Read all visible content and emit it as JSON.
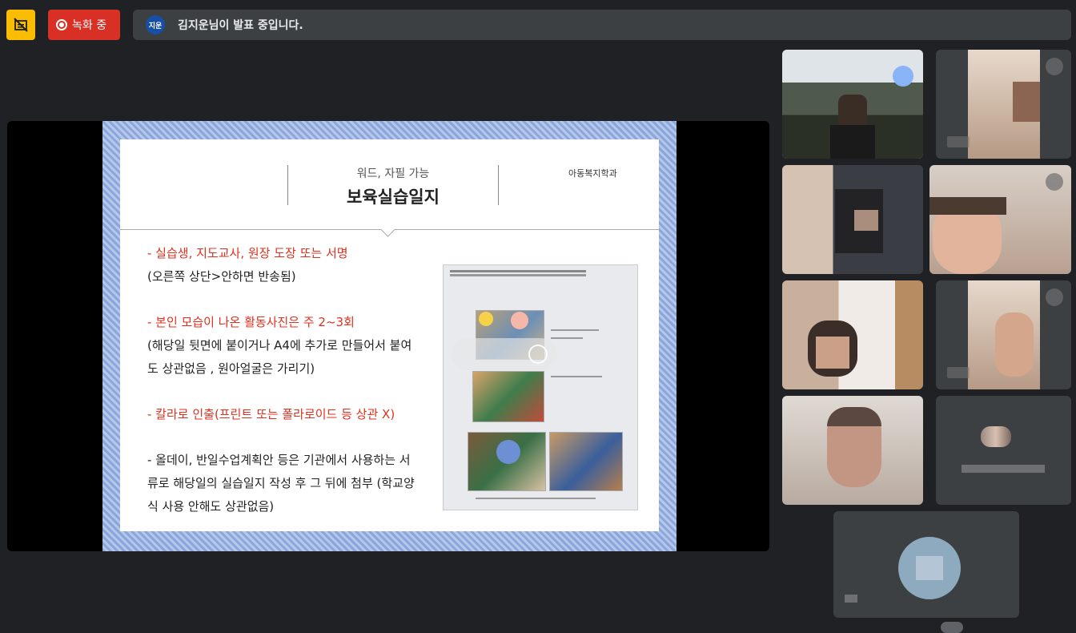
{
  "top_bar": {
    "captions_icon": "captions-off-icon",
    "recording_label": "녹화 중",
    "presenter_avatar_text": "지운",
    "presenter_status": "김지운님이 발표 중입니다."
  },
  "slide": {
    "subtitle": "워드, 자필 가능",
    "title": "보육실습일지",
    "department": "아동복지학과",
    "bullets": [
      {
        "text": "-  실습생, 지도교사, 원장 도장 또는 서명",
        "color": "red"
      },
      {
        "text": "(오른쪽 상단>안하면 반송됨)",
        "color": "black"
      },
      {
        "text": "- 본인 모습이 나온 활동사진은 주 2~3회",
        "color": "red"
      },
      {
        "text": "(해당일 뒷면에 붙이거나 A4에 추가로 만들어서 붙여",
        "color": "black"
      },
      {
        "text": "도 상관없음 , 원아얼굴은 가리기)",
        "color": "black"
      },
      {
        "text": " - 칼라로 인출(프린트 또는 폴라로이드 등 상관 X)",
        "color": "red"
      },
      {
        "text": "-  올데이, 반일수업계획안 등은 기관에서 사용하는 서",
        "color": "black"
      },
      {
        "text": "류로 해당일의 실습일지 작성 후 그 뒤에 첨부 (학교양",
        "color": "black"
      },
      {
        "text": "식 사용 안해도 상관없음)",
        "color": "black"
      }
    ]
  },
  "colors": {
    "background": "#202124",
    "recording": "#d93025",
    "captions_button": "#fbbc04",
    "active_speaker": "#8ab4f8",
    "slide_red": "#e0301e"
  }
}
